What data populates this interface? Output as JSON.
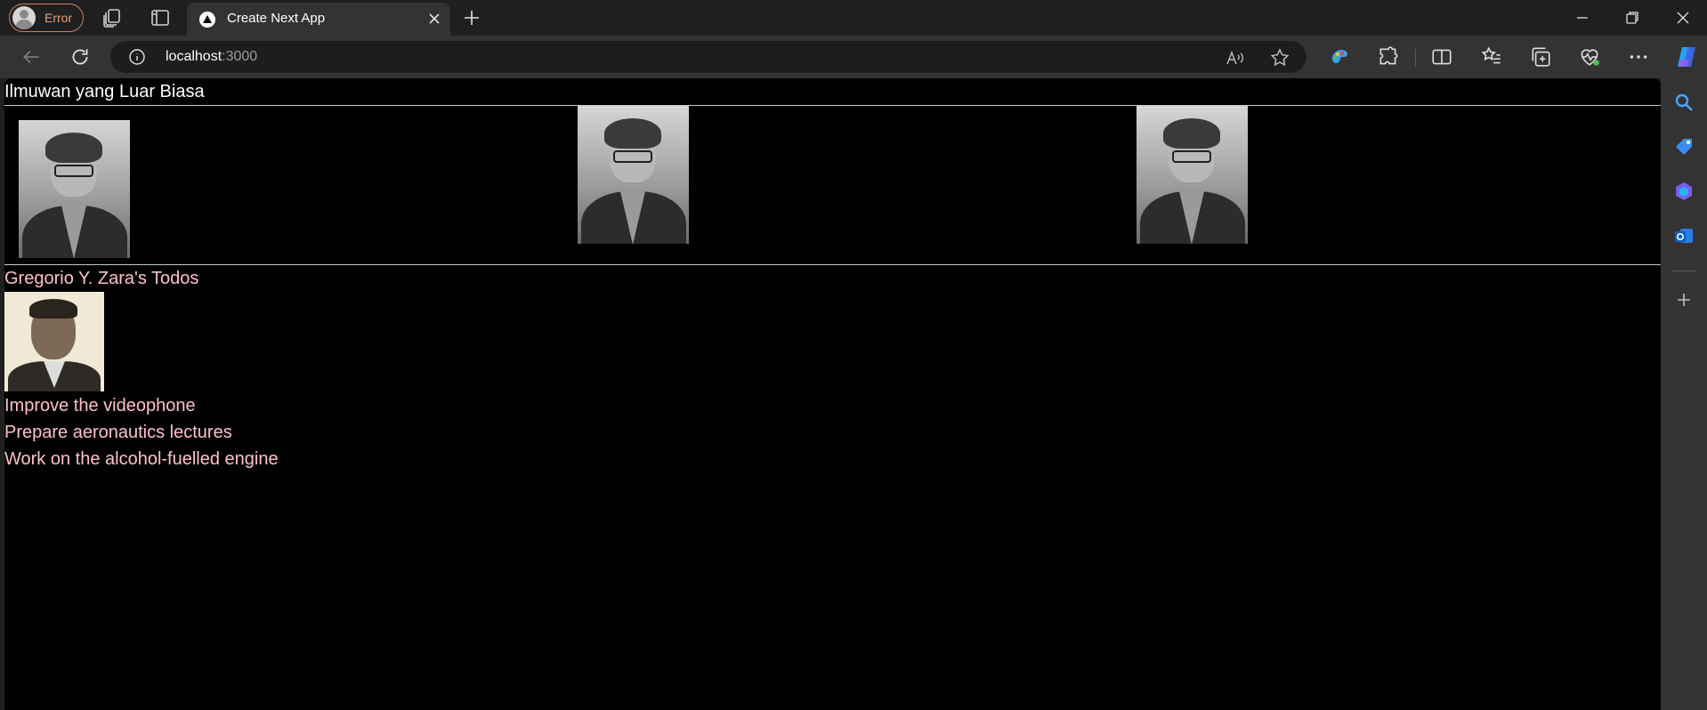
{
  "browser": {
    "profile_label": "Error",
    "tab_title": "Create Next App",
    "url_host": "localhost",
    "url_port": ":3000"
  },
  "page": {
    "heading": "Ilmuwan yang Luar Biasa",
    "scientist_photos": [
      "photo-1",
      "photo-2",
      "photo-3"
    ],
    "scientist_name": "Gregorio Y. Zara's Todos",
    "todos": [
      "Improve the videophone",
      "Prepare aeronautics lectures",
      "Work on the alcohol-fuelled engine"
    ]
  },
  "colors": {
    "page_background": "#000000",
    "heading_text": "#ffffff",
    "todo_text": "#ffc0cb",
    "profile_accent": "#c7845c"
  }
}
